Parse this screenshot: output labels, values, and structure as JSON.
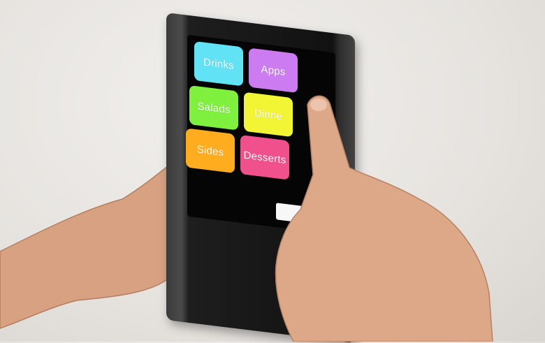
{
  "device": {
    "menu_tiles": [
      {
        "label": "Drinks",
        "color": "#62e2f5"
      },
      {
        "label": "Apps",
        "color": "#cc7cf0"
      },
      {
        "label": "Salads",
        "color": "#7ff03d"
      },
      {
        "label": "Dinne",
        "color": "#f2f534"
      },
      {
        "label": "Sides",
        "color": "#ffad1f"
      },
      {
        "label": "Desserts",
        "color": "#f0508c"
      }
    ],
    "bottom_button_color": "#f7f7f7"
  },
  "colors": {
    "background": "#e6e3df",
    "device_body": "#1a1a1a",
    "skin": "#d9a383"
  }
}
